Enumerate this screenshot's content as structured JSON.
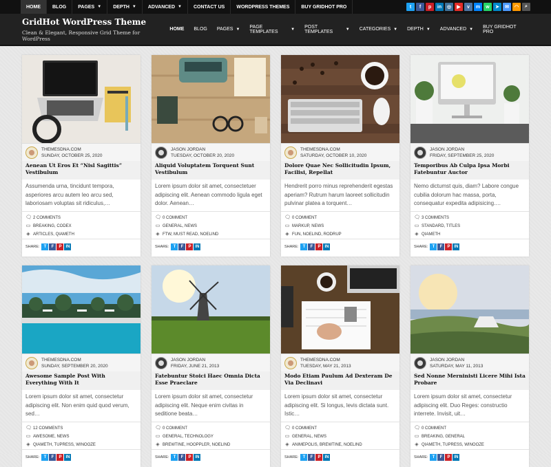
{
  "topbar": {
    "items": [
      {
        "label": "Home",
        "caret": false
      },
      {
        "label": "Blog",
        "caret": false
      },
      {
        "label": "Pages",
        "caret": true
      },
      {
        "label": "Depth",
        "caret": true
      },
      {
        "label": "Advanced",
        "caret": true
      },
      {
        "label": "Contact Us",
        "caret": false
      },
      {
        "label": "WordPress Themes",
        "caret": false
      },
      {
        "label": "Buy GridHot Pro",
        "caret": false
      }
    ],
    "socials": [
      {
        "icon": "twitter-icon",
        "glyph": "t",
        "color": "#1da1f2"
      },
      {
        "icon": "facebook-icon",
        "glyph": "f",
        "color": "#3b5998"
      },
      {
        "icon": "pinterest-icon",
        "glyph": "p",
        "color": "#cb2027"
      },
      {
        "icon": "linkedin-icon",
        "glyph": "in",
        "color": "#0077b5"
      },
      {
        "icon": "instagram-icon",
        "glyph": "◎",
        "color": "#3f729b"
      },
      {
        "icon": "youtube-icon",
        "glyph": "▶",
        "color": "#e52d27"
      },
      {
        "icon": "vk-icon",
        "glyph": "v",
        "color": "#4c75a3"
      },
      {
        "icon": "messenger-icon",
        "glyph": "m",
        "color": "#0084ff"
      },
      {
        "icon": "whatsapp-icon",
        "glyph": "w",
        "color": "#25d366"
      },
      {
        "icon": "telegram-icon",
        "glyph": "➤",
        "color": "#0088cc"
      },
      {
        "icon": "email-icon",
        "glyph": "✉",
        "color": "#4c9aff"
      },
      {
        "icon": "rss-icon",
        "glyph": "◠",
        "color": "#ff9900"
      },
      {
        "icon": "search-icon",
        "glyph": "⌕",
        "color": "#555555"
      }
    ]
  },
  "header": {
    "title": "GridHot WordPress Theme",
    "tagline": "Clean & Elegant, Responsive Grid Theme for WordPress",
    "nav": [
      {
        "label": "Home",
        "caret": false,
        "active": true
      },
      {
        "label": "Blog",
        "caret": false
      },
      {
        "label": "Pages",
        "caret": true
      },
      {
        "label": "Page Templates",
        "caret": true
      },
      {
        "label": "Post Templates",
        "caret": true
      },
      {
        "label": "Categories",
        "caret": true
      },
      {
        "label": "Depth",
        "caret": true
      },
      {
        "label": "Advanced",
        "caret": true
      },
      {
        "label": "Buy GridHot Pro",
        "caret": false
      }
    ]
  },
  "share_label": "Share:",
  "posts": [
    {
      "author": "ThemesDNA.com",
      "date": "Sunday, October 25, 2020",
      "avatar": "light",
      "title": "Aenean Ut Eros Et “Nisl Sagittis” Vestibulum",
      "excerpt": "Assumenda urna, tincidunt tempora, asperiores arcu autem leo arcu sed, laboriosam voluptas sit ridiculus,…",
      "comments": "2 Comments",
      "categories": "Breaking, Codex",
      "tags": "Articles, Qiameth",
      "image": "laptop"
    },
    {
      "author": "Jason Jordan",
      "date": "Tuesday, October 20, 2020",
      "avatar": "dark",
      "title": "Aliquid Voluptatem Torquent Sunt Vestibulum",
      "excerpt": "Lorem ipsum dolor sit amet, consectetuer adipiscing elit. Aenean commodo ligula eget dolor. Aenean…",
      "comments": "0 Comment",
      "categories": "General, News",
      "tags": "FTW, Must Read, Noelind",
      "image": "typewriter"
    },
    {
      "author": "ThemesDNA.com",
      "date": "Saturday, October 10, 2020",
      "avatar": "light",
      "title": "Dolore Quae Nec Sollicitudin Ipsum, Facilisi, Repellat",
      "excerpt": "Hendrerit porro minus reprehenderit egestas aperiam? Rutrum harum laoreet sollicitudin pulvinar platea a torquent…",
      "comments": "0 Comment",
      "categories": "Markup, News",
      "tags": "Fun, Noelind, Rodrup",
      "image": "keyboard"
    },
    {
      "author": "Jason Jordan",
      "date": "Friday, September 25, 2020",
      "avatar": "dark",
      "title": "Temporibus Ab Culpa Ipsa Morbi Fatebuntur Auctor",
      "excerpt": "Nemo dictumst quis, diam? Labore congue cubilia dolorum hac massa, porta, consequatur expedita adipisicing.…",
      "comments": "3 Comments",
      "categories": "Standard, Titles",
      "tags": "Qiameth",
      "image": "desk"
    },
    {
      "author": "ThemesDNA.com",
      "date": "Sunday, September 20, 2020",
      "avatar": "light",
      "title": "Awesome Sample Post With Everything With It",
      "excerpt": "Lorem ipsum dolor sit amet, consectetur adipiscing elit. Non enim quid quod verum, sed…",
      "comments": "12 Comments",
      "categories": "Awesome, News",
      "tags": "Qiameth, Tupress, Winooze",
      "image": "pool"
    },
    {
      "author": "Jason Jordan",
      "date": "Friday, June 21, 2013",
      "avatar": "dark",
      "title": "Fatebuntur Stoici Haec Omnia Dicta Esse Praeclare",
      "excerpt": "Lorem ipsum dolor sit amet, consectetur adipiscing elit. Neque enim civitas in seditione beata…",
      "comments": "0 Comment",
      "categories": "General, Technology",
      "tags": "Brewtine, Hooppler, Noelind",
      "image": "windmill"
    },
    {
      "author": "ThemesDNA.com",
      "date": "Tuesday, May 21, 2013",
      "avatar": "light",
      "title": "Modo Etiam Paulum Ad Dexteram De Via Declinavi",
      "excerpt": "Lorem ipsum dolor sit amet, consectetur adipiscing elit. Si longus, levis dictata sunt. Istic…",
      "comments": "0 Comment",
      "categories": "General, News",
      "tags": "Animepolis, Brewtine, Noelind",
      "image": "notebook"
    },
    {
      "author": "Jason Jordan",
      "date": "Saturday, May 11, 2013",
      "avatar": "dark",
      "title": "Sed Nonne Merninisti Licere Mihi Ista Probare",
      "excerpt": "Lorem ipsum dolor sit amet, consectetur adipiscing elit. Duo Reges: constructio interrete. Invisit, uit…",
      "comments": "0 Comment",
      "categories": "Breaking, General",
      "tags": "Qiameth, Tupress, Winooze",
      "image": "tent"
    }
  ]
}
